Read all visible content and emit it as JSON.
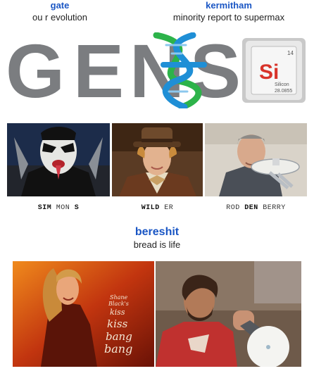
{
  "entries": {
    "gate": {
      "user": "gate",
      "caption": "ou r evolution"
    },
    "kermitham": {
      "user": "kermitham",
      "caption": "minority report to supermax"
    },
    "bereshit": {
      "user": "bereshit",
      "caption": "bread is life"
    }
  },
  "logo": {
    "letters": [
      "G",
      "E",
      "N",
      "S"
    ],
    "element_tile": {
      "symbol": "Si",
      "number": "14",
      "name": "Silicon",
      "mass": "28.0855"
    },
    "colors": {
      "letters": "#7b7d80",
      "helix_blue": "#1f8fd6",
      "helix_green": "#2db34a"
    }
  },
  "portraits": [
    {
      "label_parts": [
        {
          "t": "SIM",
          "b": true
        },
        {
          "t": " MON ",
          "b": false
        },
        {
          "t": "S",
          "b": true
        }
      ]
    },
    {
      "label_parts": [
        {
          "t": "WILD",
          "b": true
        },
        {
          "t": " ER",
          "b": false
        }
      ]
    },
    {
      "label_parts": [
        {
          "t": "ROD ",
          "b": false
        },
        {
          "t": "DEN",
          "b": true
        },
        {
          "t": " BERRY",
          "b": false
        }
      ]
    }
  ],
  "poster": {
    "credit_lines": [
      "Shane",
      "Black's"
    ],
    "title_lines": [
      "kiss",
      "kiss",
      "bang",
      "bang"
    ]
  }
}
